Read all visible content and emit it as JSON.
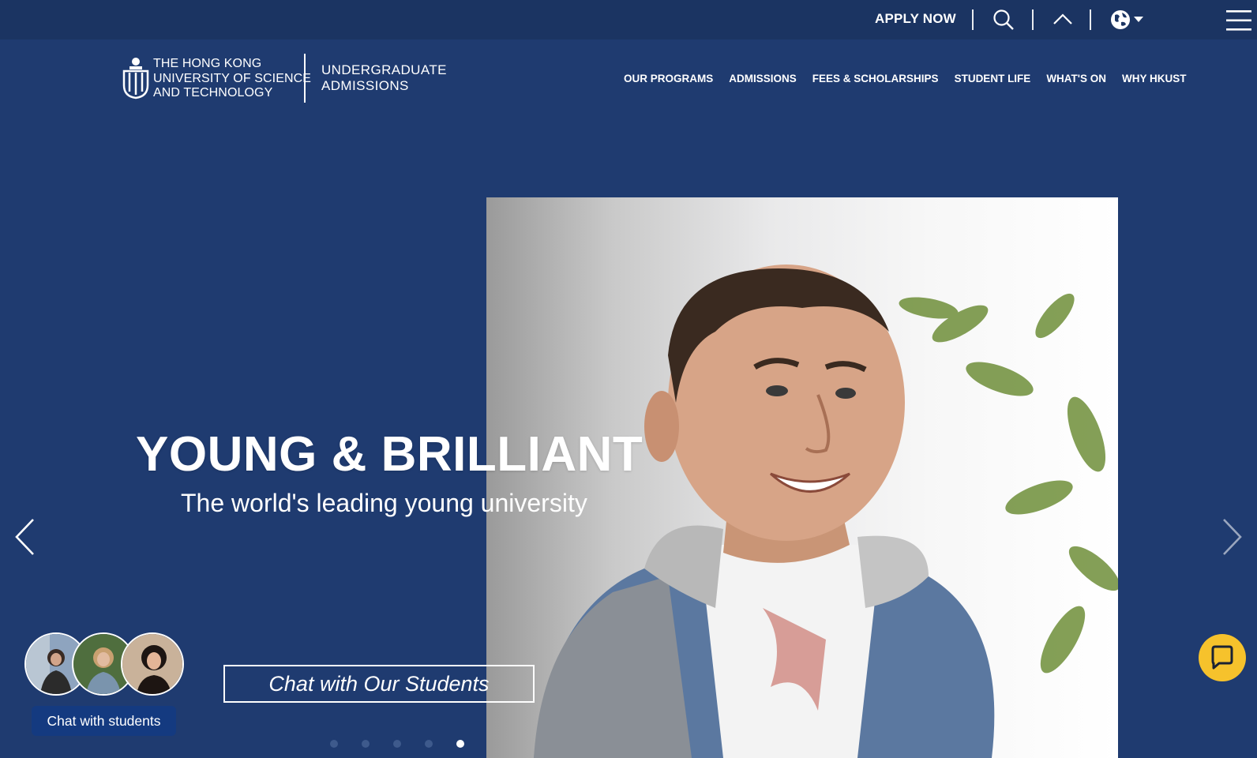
{
  "topbar": {
    "apply_label": "APPLY NOW",
    "icons": [
      "search-icon",
      "chevron-up-icon",
      "globe-icon",
      "hamburger-menu-icon"
    ]
  },
  "logo": {
    "line1": "THE HONG KONG",
    "line2": "UNIVERSITY OF SCIENCE",
    "line3": "AND TECHNOLOGY"
  },
  "site": {
    "line1": "UNDERGRADUATE",
    "line2": "ADMISSIONS"
  },
  "nav": {
    "items": [
      {
        "label": "OUR PROGRAMS"
      },
      {
        "label": "ADMISSIONS"
      },
      {
        "label": "FEES & SCHOLARSHIPS"
      },
      {
        "label": "STUDENT LIFE"
      },
      {
        "label": "WHAT'S ON"
      },
      {
        "label": "WHY HKUST"
      }
    ]
  },
  "hero": {
    "headline": "YOUNG & BRILLIANT",
    "subline": "The world's leading young university",
    "cta_label": "Chat with Our Students",
    "slides_total": 5,
    "active_slide": 5
  },
  "chat_widget": {
    "label": "Chat with students"
  },
  "colors": {
    "background": "#1f3b70",
    "topbar": "#1b3462",
    "chat_pill": "#143a80",
    "fab": "#f6c22c"
  }
}
